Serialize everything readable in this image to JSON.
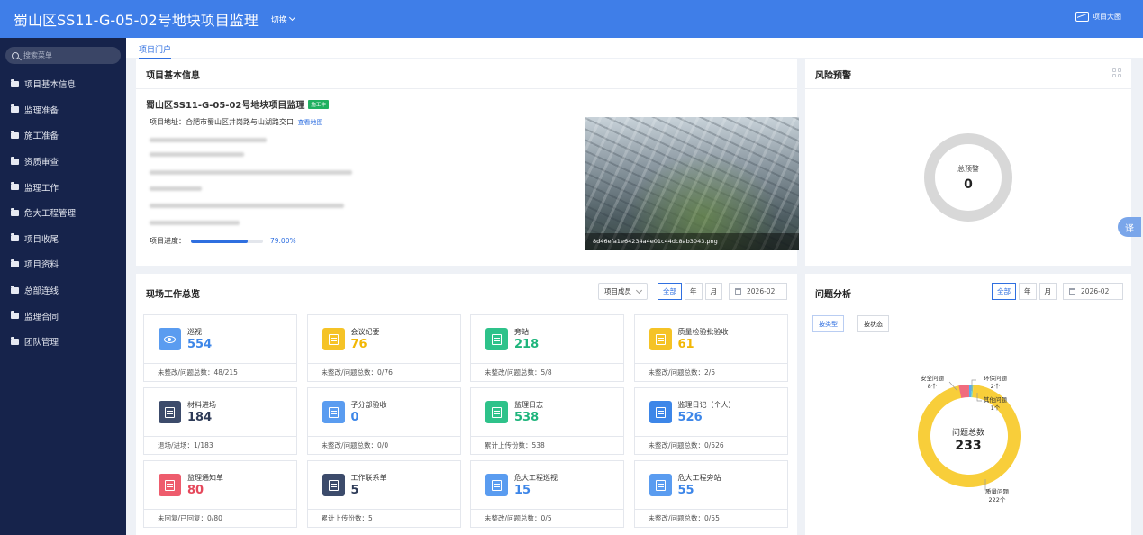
{
  "header": {
    "title": "蜀山区SS11-G-05-02号地块项目监理",
    "switch_label": "切换",
    "big_screen_label": "项目大图"
  },
  "sidebar": {
    "search_placeholder": "搜索菜单",
    "items": [
      {
        "label": "项目基本信息"
      },
      {
        "label": "监理准备"
      },
      {
        "label": "施工准备"
      },
      {
        "label": "资质审查"
      },
      {
        "label": "监理工作"
      },
      {
        "label": "危大工程管理"
      },
      {
        "label": "项目收尾"
      },
      {
        "label": "项目资料"
      },
      {
        "label": "总部连线"
      },
      {
        "label": "监理合同"
      },
      {
        "label": "团队管理"
      }
    ]
  },
  "tabs": [
    {
      "label": "项目门户",
      "active": true
    }
  ],
  "project_info": {
    "panel_title": "项目基本信息",
    "name": "蜀山区SS11-G-05-02号地块项目监理",
    "status_badge": "施工中",
    "address_label": "项目地址：",
    "address": "合肥市蜀山区井岗路与山湖路交口",
    "map_link": "查看地图",
    "progress_label": "项目进度：",
    "progress_value": 79.0,
    "progress_text": "79.00%",
    "photo_caption": "8d46efa1e64234a4e01c44dc8ab3043.png"
  },
  "risk": {
    "panel_title": "风险预警",
    "center_label": "总预警",
    "center_value": "0"
  },
  "site_overview": {
    "panel_title": "现场工作总览",
    "member_select": "项目成员",
    "periods": [
      "全部",
      "年",
      "月"
    ],
    "active_period": "全部",
    "date": "2026-02",
    "cards": [
      {
        "label": "巡视",
        "value": "554",
        "foot": "未整改/问题总数：48/215",
        "color": "#5a9cf0",
        "value_color": "#3d86e8",
        "icon": "eye-icon"
      },
      {
        "label": "会议纪要",
        "value": "76",
        "foot": "未整改/问题总数：0/76",
        "color": "#f5c326",
        "value_color": "#f2b705",
        "icon": "document-icon"
      },
      {
        "label": "旁站",
        "value": "218",
        "foot": "未整改/问题总数：5/8",
        "color": "#2ec28a",
        "value_color": "#1fb57c",
        "icon": "person-icon"
      },
      {
        "label": "质量检验批验收",
        "value": "61",
        "foot": "未整改/问题总数：2/5",
        "color": "#f5c326",
        "value_color": "#f2b705",
        "icon": "document-search-icon"
      },
      {
        "label": "材料进场",
        "value": "184",
        "foot": "退场/进场：1/183",
        "color": "#3c4b6b",
        "value_color": "#2d3a57",
        "icon": "truck-icon"
      },
      {
        "label": "子分部验收",
        "value": "0",
        "foot": "未整改/问题总数：0/0",
        "color": "#5a9cf0",
        "value_color": "#3d86e8",
        "icon": "document-icon"
      },
      {
        "label": "监理日志",
        "value": "538",
        "foot": "累计上传份数：538",
        "color": "#2ec28a",
        "value_color": "#1fb57c",
        "icon": "document-icon"
      },
      {
        "label": "监理日记（个人）",
        "value": "526",
        "foot": "未整改/问题总数：0/526",
        "color": "#3d86e8",
        "value_color": "#3d86e8",
        "icon": "pen-icon"
      },
      {
        "label": "监理通知单",
        "value": "80",
        "foot": "未回复/已回复：0/80",
        "color": "#ee5c6d",
        "value_color": "#e5485b",
        "icon": "notice-icon"
      },
      {
        "label": "工作联系单",
        "value": "5",
        "foot": "累计上传份数：5",
        "color": "#3c4b6b",
        "value_color": "#2d3a57",
        "icon": "document-icon"
      },
      {
        "label": "危大工程巡视",
        "value": "15",
        "foot": "未整改/问题总数：0/5",
        "color": "#5a9cf0",
        "value_color": "#3d86e8",
        "icon": "document-icon"
      },
      {
        "label": "危大工程旁站",
        "value": "55",
        "foot": "未整改/问题总数：0/55",
        "color": "#5a9cf0",
        "value_color": "#3d86e8",
        "icon": "document-icon"
      }
    ]
  },
  "issues": {
    "panel_title": "问题分析",
    "periods": [
      "全部",
      "年",
      "月"
    ],
    "active_period": "全部",
    "date": "2026-02",
    "view_tabs": [
      "按类型",
      "按状态"
    ],
    "active_view": "按类型",
    "center_label": "问题总数",
    "center_value": "233"
  },
  "chart_data": {
    "type": "pie",
    "categories": [
      "质量问题",
      "安全问题",
      "环保问题",
      "其他问题"
    ],
    "values": [
      222,
      8,
      2,
      1
    ],
    "value_labels": [
      "222个",
      "8个",
      "2个",
      "1个"
    ],
    "colors": [
      "#f8ce3a",
      "#f06c7e",
      "#58aef0",
      "#7ed9a4"
    ]
  },
  "translate_label": "译"
}
